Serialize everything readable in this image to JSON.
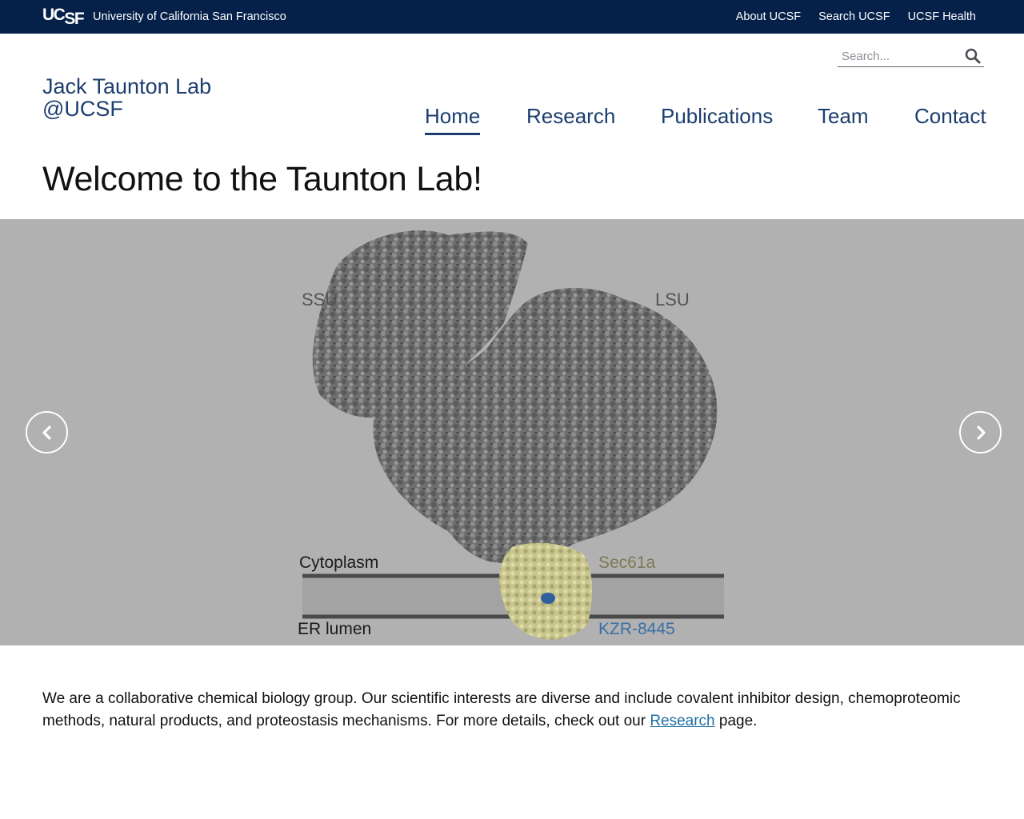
{
  "topbar": {
    "logo_uc": "UC",
    "logo_sf": "SF",
    "university_name": "University of California San Francisco",
    "links": [
      "About UCSF",
      "Search UCSF",
      "UCSF Health"
    ]
  },
  "header": {
    "lab_title_line1": "Jack Taunton Lab",
    "lab_title_line2": "@UCSF",
    "search_placeholder": "Search..."
  },
  "nav": {
    "items": [
      "Home",
      "Research",
      "Publications",
      "Team",
      "Contact"
    ],
    "active": "Home"
  },
  "page": {
    "title": "Welcome to the Taunton Lab!"
  },
  "carousel": {
    "labels": {
      "ssu": "SSU",
      "lsu": "LSU",
      "cytoplasm": "Cytoplasm",
      "er_lumen": "ER lumen",
      "sec61a": "Sec61a",
      "kzr": "KZR-8445"
    },
    "colors": {
      "background": "#b1b1b1",
      "sec61a": "#7c7a52",
      "kzr": "#3a6ea5"
    }
  },
  "intro": {
    "text_before": "We are a collaborative chemical biology group. Our scientific interests are diverse and include covalent inhibitor design, chemoproteomic methods, natural products, and proteostasis mechanisms. For more details, check out our ",
    "link_text": "Research",
    "text_after": " page."
  },
  "colors": {
    "topbar": "#052049",
    "nav_text": "#1c3e6e",
    "link": "#1f6fa3"
  }
}
